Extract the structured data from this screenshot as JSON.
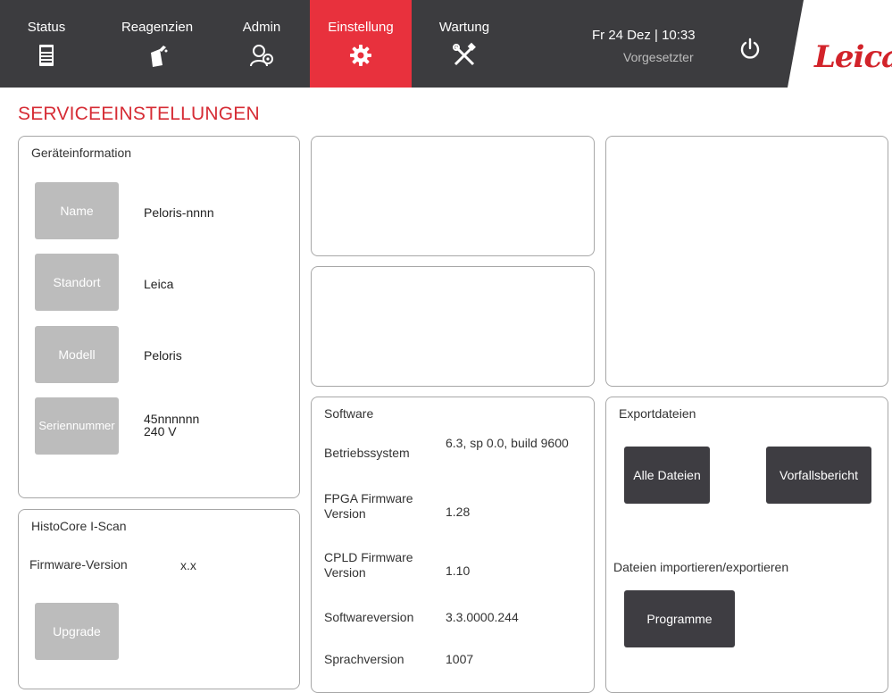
{
  "nav": {
    "tabs": [
      {
        "label": "Status",
        "icon": "processor-icon"
      },
      {
        "label": "Reagenzien",
        "icon": "reagent-bottle-icon"
      },
      {
        "label": "Admin",
        "icon": "admin-user-icon"
      },
      {
        "label": "Einstellung",
        "icon": "settings-gear-icon"
      },
      {
        "label": "Wartung",
        "icon": "tools-icon"
      }
    ],
    "active_tab": "Einstellung",
    "datetime": "Fr 24 Dez | 10:33",
    "role": "Vorgesetzter",
    "logo": "Leica",
    "active_color": "#e8313d"
  },
  "page": {
    "title": "SERVICEEINSTELLUNGEN",
    "title_color": "#d62c35"
  },
  "device_info": {
    "title": "Geräteinformation",
    "rows": [
      {
        "button": "Name",
        "value": "Peloris-nnnn"
      },
      {
        "button": "Standort",
        "value": "Leica"
      },
      {
        "button": "Modell",
        "value": "Peloris"
      },
      {
        "button": "Seriennummer",
        "value": "45nnnnnn",
        "value2": "240 V"
      }
    ]
  },
  "iscan": {
    "title": "HistoCore I-Scan",
    "firmware_label": "Firmware-Version",
    "firmware_value": "x.x",
    "upgrade_button": "Upgrade"
  },
  "software": {
    "title": "Software",
    "rows": [
      {
        "label": "Betriebssystem",
        "value": "6.3, sp 0.0, build 9600"
      },
      {
        "label": "FPGA Firmware Version",
        "value": "1.28"
      },
      {
        "label": "CPLD Firmware Version",
        "value": "1.10"
      },
      {
        "label": "Softwareversion",
        "value": "3.3.0000.244"
      },
      {
        "label": "Sprachversion",
        "value": "1007"
      }
    ]
  },
  "export": {
    "title": "Exportdateien",
    "all_files_button": "Alle Dateien",
    "incident_button": "Vorfallsbericht",
    "import_export_label": "Dateien importieren/exportieren",
    "programs_button": "Programme"
  }
}
